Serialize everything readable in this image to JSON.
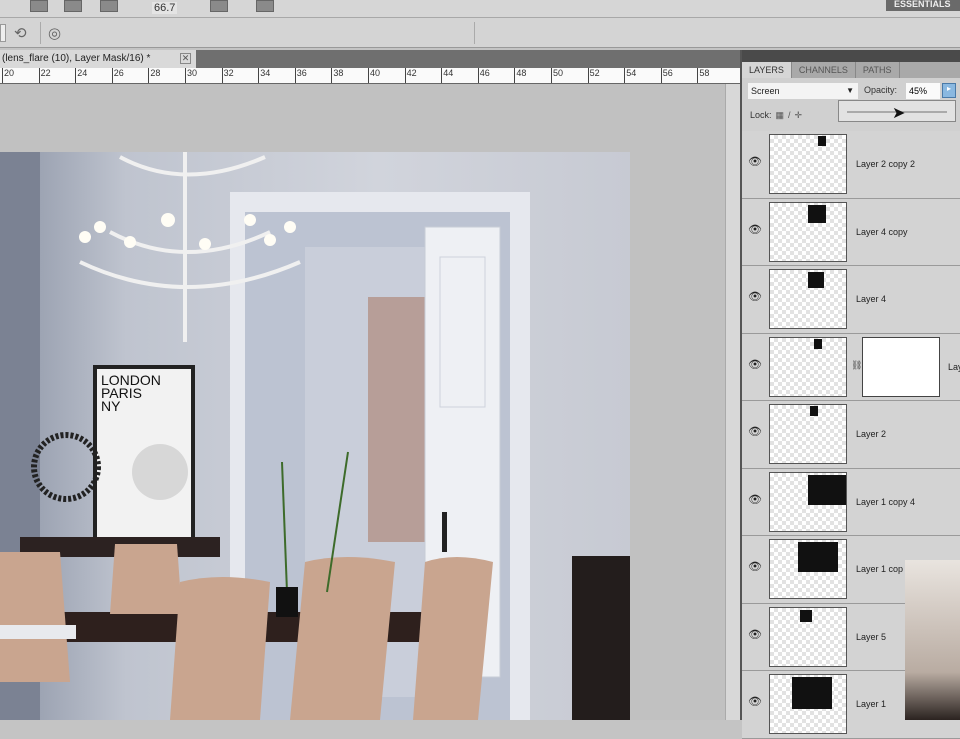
{
  "app": {
    "workspace_button": "ESSENTIALS",
    "zoom_level": "66.7"
  },
  "document": {
    "tab_title": "(lens_flare (10), Layer Mask/16) *",
    "close": "✕"
  },
  "ruler": {
    "ticks": [
      "20",
      "22",
      "24",
      "26",
      "28",
      "30",
      "32",
      "34",
      "36",
      "38",
      "40",
      "42",
      "44",
      "46",
      "48",
      "50",
      "52",
      "54",
      "56",
      "58"
    ]
  },
  "photo": {
    "poster_text": [
      "LONDON",
      "PARIS",
      "NY"
    ]
  },
  "layers_panel": {
    "tabs": [
      "LAYERS",
      "CHANNELS",
      "PATHS"
    ],
    "blend_mode": "Screen",
    "opacity_label": "Opacity:",
    "opacity_value": "45%",
    "lock_label": "Lock:",
    "layers": [
      {
        "name": "Layer 2 copy 2"
      },
      {
        "name": "Layer 4 copy"
      },
      {
        "name": "Layer 4"
      },
      {
        "name": "Lay"
      },
      {
        "name": "Layer 2"
      },
      {
        "name": "Layer 1 copy 4"
      },
      {
        "name": "Layer 1 cop"
      },
      {
        "name": "Layer 5"
      },
      {
        "name": "Layer 1"
      }
    ]
  }
}
